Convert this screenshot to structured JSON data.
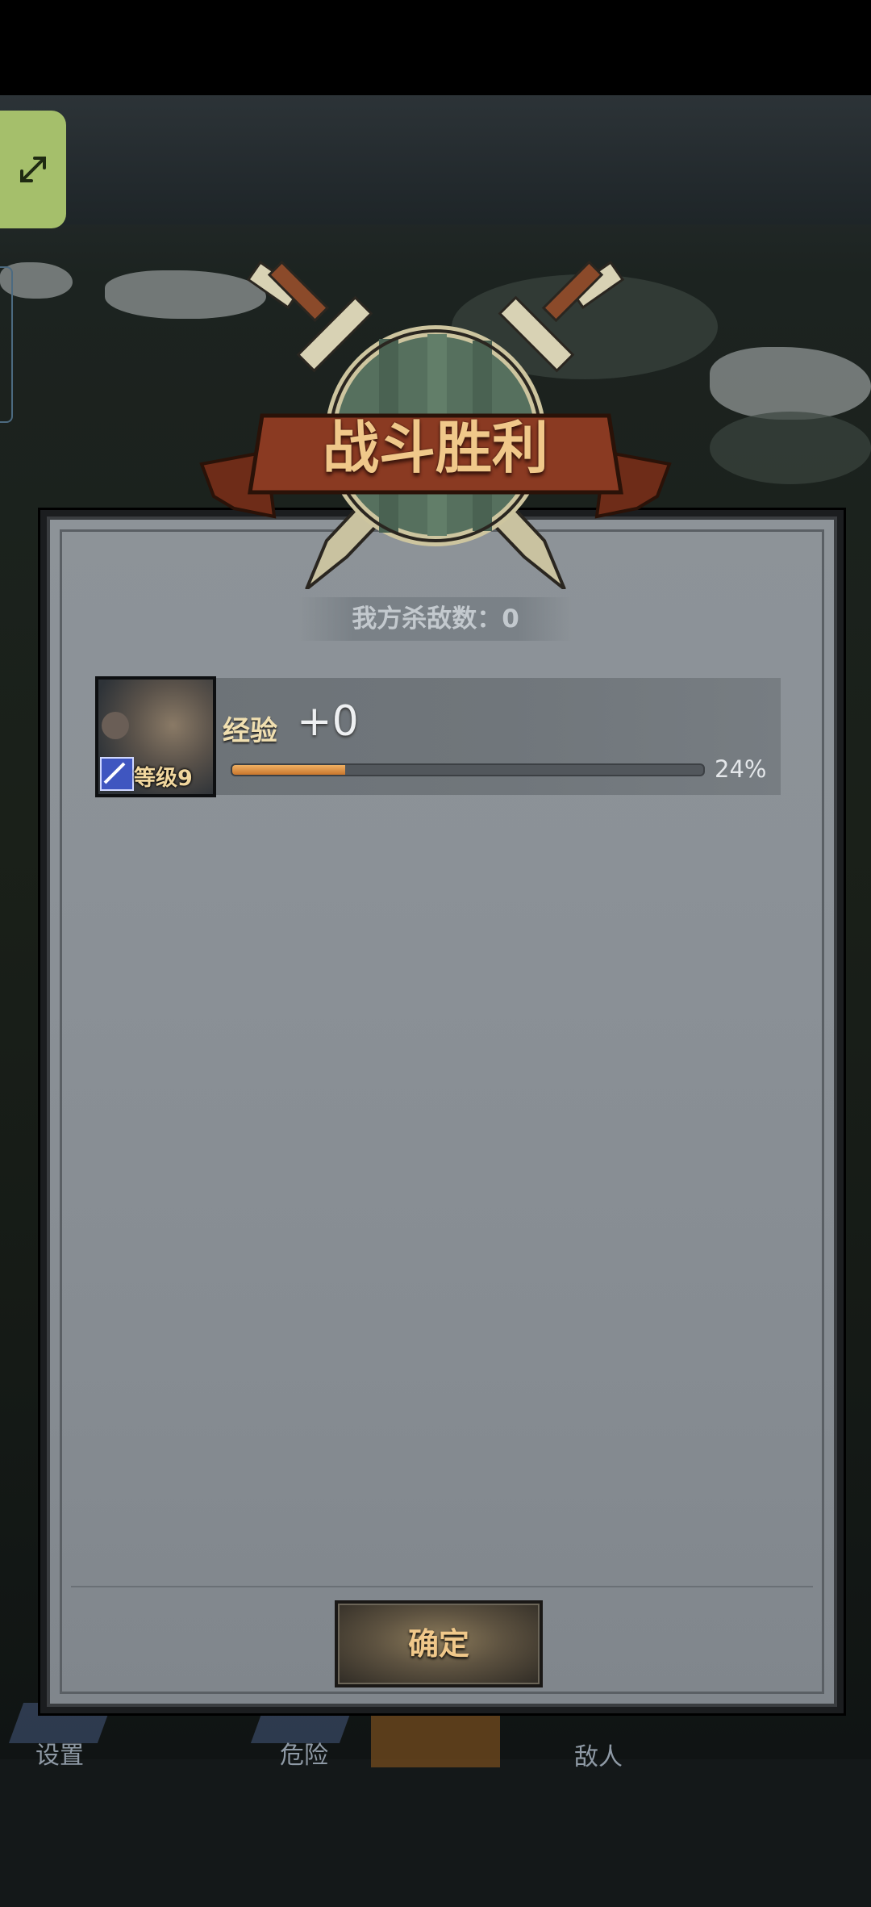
{
  "dialog": {
    "title": "战斗胜利",
    "kills_text": "我方杀敌数：0",
    "hero": {
      "level_text": "等级9",
      "exp_label": "经验",
      "exp_gain": "+0",
      "progress_percent": 24,
      "progress_text": "24%"
    },
    "confirm_label": "确定"
  },
  "background_nav": {
    "items": [
      "设置",
      "危险"
    ],
    "hint_text": "敌人"
  },
  "colors": {
    "title_gold": "#f0c88a",
    "ribbon_red": "#8a3a22",
    "progress_orange": "#e09a48",
    "expand_green": "#a5bf6b"
  },
  "icons": [
    "expand-icon",
    "crossed-swords-emblem",
    "helmet-icon",
    "sword-icon"
  ]
}
